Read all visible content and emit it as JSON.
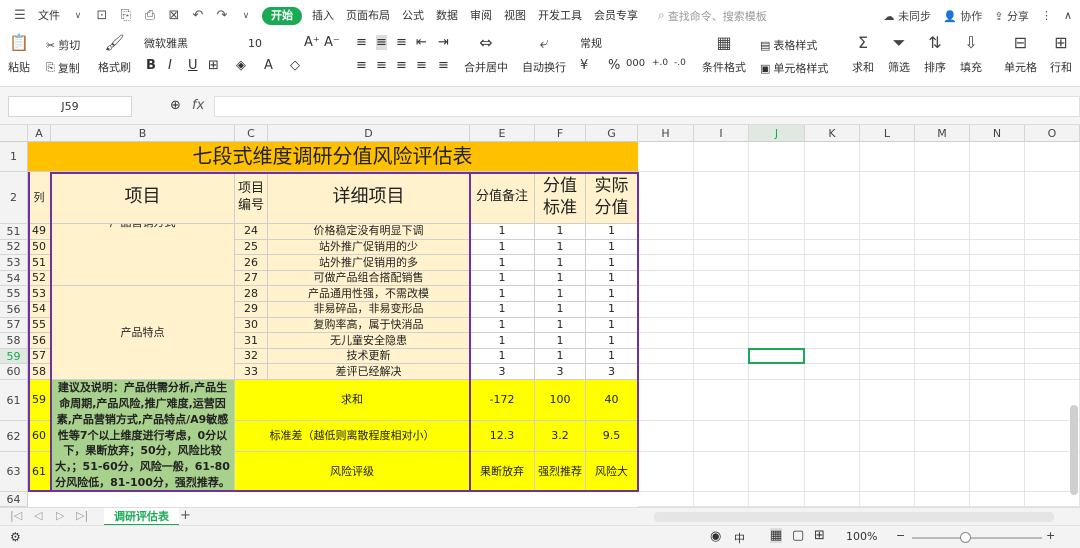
{
  "menu": {
    "hamburger_label": "文件",
    "items": [
      "插入",
      "页面布局",
      "公式",
      "数据",
      "审阅",
      "视图",
      "开发工具",
      "会员专享"
    ],
    "active": "开始",
    "search_placeholder": "查找命令、搜索模板",
    "right": [
      "未同步",
      "协作",
      "分享"
    ]
  },
  "ribbon": {
    "paste": "粘贴",
    "cut": "剪切",
    "copy": "复制",
    "format_painter": "格式刷",
    "font_name": "微软雅黑",
    "font_size": "10",
    "merge_center": "合并居中",
    "wrap": "自动换行",
    "number_format": "常规",
    "cond_format": "条件格式",
    "table_style": "表格样式",
    "cell_style": "单元格样式",
    "sum": "求和",
    "filter": "筛选",
    "sort": "排序",
    "fill": "填充",
    "cell": "单元格",
    "rowcol": "行和"
  },
  "formula": {
    "namebox": "J59",
    "fx": "fx",
    "value": ""
  },
  "columns": [
    "A",
    "B",
    "C",
    "D",
    "E",
    "F",
    "G",
    "H",
    "I",
    "J",
    "K",
    "L",
    "M",
    "N",
    "O"
  ],
  "rowheaders": [
    "1",
    "2",
    "51",
    "52",
    "53",
    "54",
    "55",
    "56",
    "57",
    "58",
    "59",
    "60",
    "61",
    "62",
    "63",
    "64"
  ],
  "sheet": {
    "title": "七段式维度调研分值风险评估表",
    "header": {
      "col_a": "列",
      "item": "项目",
      "item_no": "项目\n编号",
      "detail": "详细项目",
      "note": "分值备注",
      "std": "分值\n标准",
      "actual": "实际\n分值"
    },
    "group1_label": "产品营销方式",
    "group2_label": "产品特点",
    "rows": [
      {
        "a": "49",
        "c": "24",
        "d": "价格稳定没有明显下调",
        "e": "1",
        "f": "1",
        "g": "1"
      },
      {
        "a": "50",
        "c": "25",
        "d": "站外推广促销用的少",
        "e": "1",
        "f": "1",
        "g": "1"
      },
      {
        "a": "51",
        "c": "26",
        "d": "站外推广促销用的多",
        "e": "1",
        "f": "1",
        "g": "1"
      },
      {
        "a": "52",
        "c": "27",
        "d": "可做产品组合搭配销售",
        "e": "1",
        "f": "1",
        "g": "1"
      },
      {
        "a": "53",
        "c": "28",
        "d": "产品通用性强，不需改模",
        "e": "1",
        "f": "1",
        "g": "1"
      },
      {
        "a": "54",
        "c": "29",
        "d": "非易碎品，非易变形品",
        "e": "1",
        "f": "1",
        "g": "1"
      },
      {
        "a": "55",
        "c": "30",
        "d": "复购率高，属于快消品",
        "e": "1",
        "f": "1",
        "g": "1"
      },
      {
        "a": "56",
        "c": "31",
        "d": "无儿童安全隐患",
        "e": "1",
        "f": "1",
        "g": "1"
      },
      {
        "a": "57",
        "c": "32",
        "d": "技术更新",
        "e": "1",
        "f": "1",
        "g": "1"
      },
      {
        "a": "58",
        "c": "33",
        "d": "差评已经解决",
        "e": "3",
        "f": "3",
        "g": "3"
      }
    ],
    "note_text": "建议及说明：产品供需分析,产品生命周期,产品风险,推广难度,运营因素,产品营销方式,产品特点/A9敏感性等7个以上维度进行考虑，0分以下，果断放弃；50分，风险比较大，；51-60分，风险一般，61-80分风险低，81-100分，强烈推荐。",
    "summary": [
      {
        "a": "59",
        "label": "求和",
        "e": "-172",
        "f": "100",
        "g": "40"
      },
      {
        "a": "60",
        "label": "标准差（越低则离散程度相对小）",
        "e": "12.3",
        "f": "3.2",
        "g": "9.5"
      },
      {
        "a": "61",
        "label": "风险评级",
        "e": "果断放弃",
        "f": "强烈推荐",
        "g": "风险大"
      }
    ]
  },
  "sheettab": "调研评估表",
  "status": {
    "zoom": "100%",
    "lang": "中"
  },
  "colors": {
    "title_bg": "#FFC000",
    "header_bg": "#FFF2CC",
    "row_bg": "#FFF2CC",
    "summary_bg": "#FFFF00",
    "note_bg": "#A9D18E",
    "border": "#7030A0",
    "accent": "#1AAA55"
  }
}
